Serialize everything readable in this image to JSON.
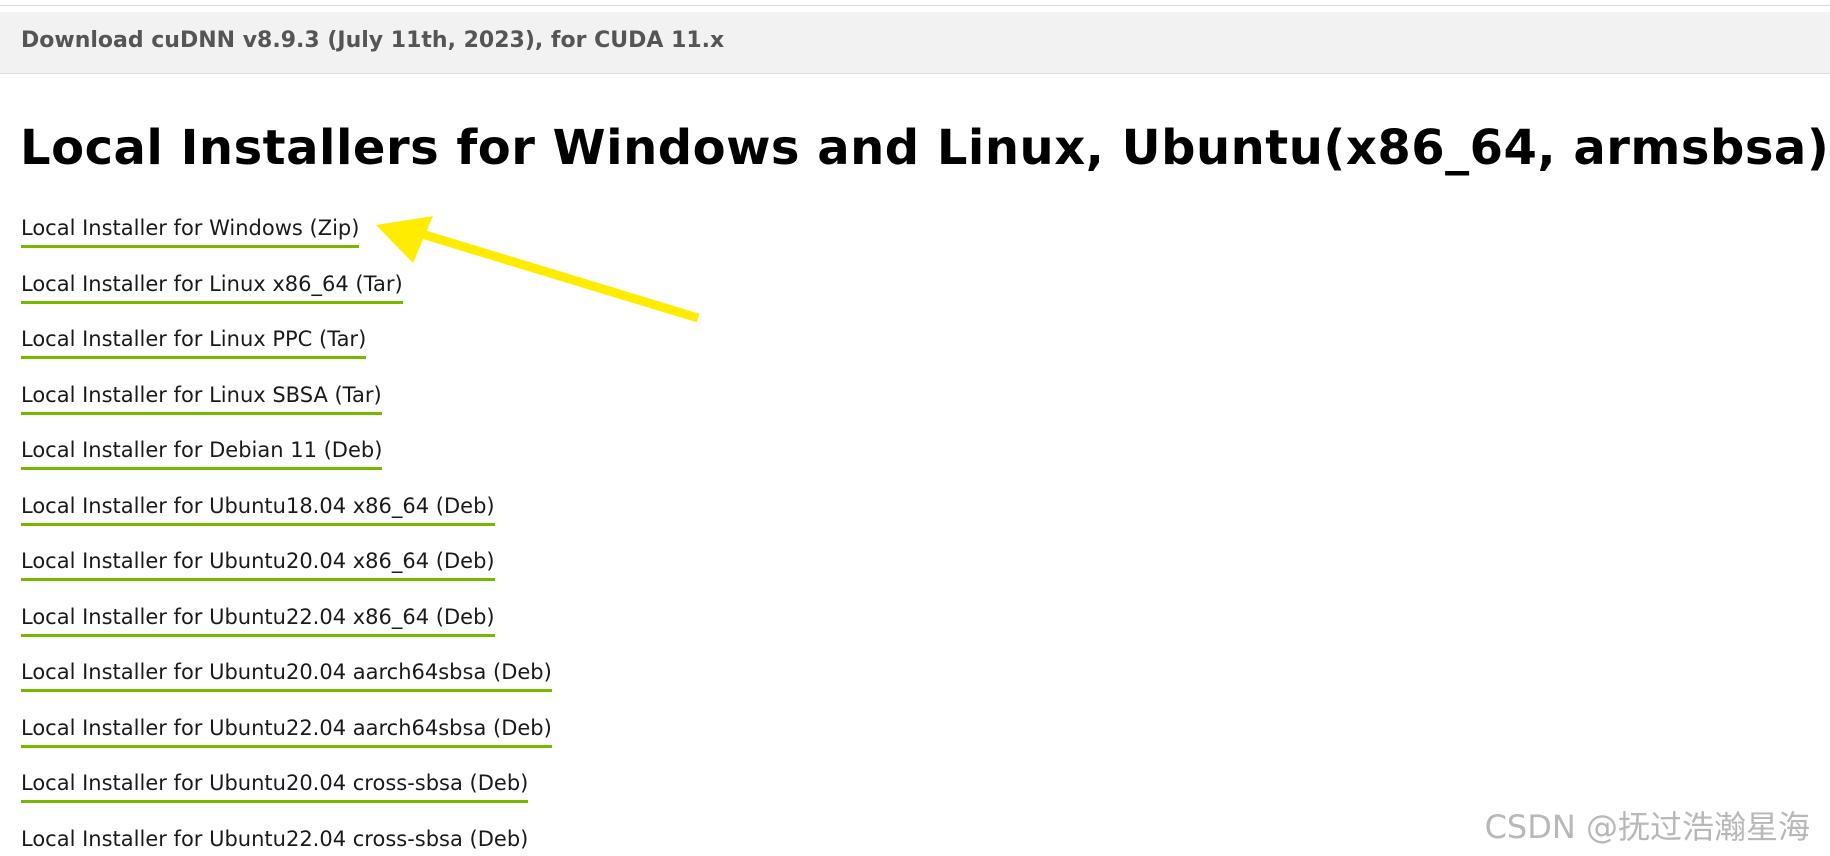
{
  "accordion": {
    "title": "Download cuDNN v8.9.3 (July 11th, 2023), for CUDA 11.x"
  },
  "section": {
    "heading": "Local Installers for Windows and Linux, Ubuntu(x86_64, armsbsa)"
  },
  "installers": [
    {
      "label": "Local Installer for Windows (Zip)"
    },
    {
      "label": "Local Installer for Linux x86_64 (Tar)"
    },
    {
      "label": "Local Installer for Linux PPC (Tar)"
    },
    {
      "label": "Local Installer for Linux SBSA (Tar)"
    },
    {
      "label": "Local Installer for Debian 11 (Deb)"
    },
    {
      "label": "Local Installer for Ubuntu18.04 x86_64 (Deb)"
    },
    {
      "label": "Local Installer for Ubuntu20.04 x86_64 (Deb)"
    },
    {
      "label": "Local Installer for Ubuntu22.04 x86_64 (Deb)"
    },
    {
      "label": "Local Installer for Ubuntu20.04 aarch64sbsa (Deb)"
    },
    {
      "label": "Local Installer for Ubuntu22.04 aarch64sbsa (Deb)"
    },
    {
      "label": "Local Installer for Ubuntu20.04 cross-sbsa (Deb)"
    },
    {
      "label": "Local Installer for Ubuntu22.04 cross-sbsa (Deb)"
    }
  ],
  "annotation": {
    "icon": "arrow-pointer-icon",
    "color": "#ffec00"
  },
  "watermark": {
    "text": "CSDN @抚过浩瀚星海"
  },
  "colors": {
    "link_underline": "#76b900",
    "header_bg": "#f2f2f2"
  }
}
